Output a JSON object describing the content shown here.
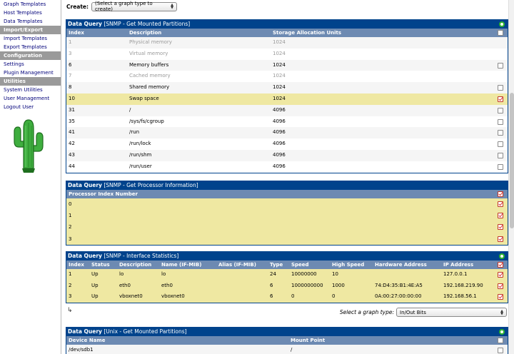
{
  "sidebar": {
    "items": [
      {
        "type": "link",
        "label": "Graph Templates"
      },
      {
        "type": "link",
        "label": "Host Templates"
      },
      {
        "type": "link",
        "label": "Data Templates"
      },
      {
        "type": "header",
        "label": "Import/Export"
      },
      {
        "type": "link",
        "label": "Import Templates"
      },
      {
        "type": "link",
        "label": "Export Templates"
      },
      {
        "type": "header",
        "label": "Configuration"
      },
      {
        "type": "link",
        "label": "Settings"
      },
      {
        "type": "link",
        "label": "Plugin Management"
      },
      {
        "type": "header",
        "label": "Utilities"
      },
      {
        "type": "link",
        "label": "System Utilities"
      },
      {
        "type": "link",
        "label": "User Management"
      },
      {
        "type": "link",
        "label": "Logout User"
      }
    ]
  },
  "create": {
    "label": "Create:",
    "select_value": "(Select a graph type to create)"
  },
  "mounted_partitions": {
    "title_prefix": "Data Query",
    "title_name": "[SNMP - Get Mounted Partitions]",
    "headers": [
      "Index",
      "Description",
      "Storage Allocation Units"
    ],
    "rows": [
      {
        "index": "1",
        "description": "Physical memory",
        "units": "1024",
        "disabled": true,
        "checked": false
      },
      {
        "index": "3",
        "description": "Virtual memory",
        "units": "1024",
        "disabled": true,
        "checked": false
      },
      {
        "index": "6",
        "description": "Memory buffers",
        "units": "1024",
        "disabled": false,
        "checked": false
      },
      {
        "index": "7",
        "description": "Cached memory",
        "units": "1024",
        "disabled": true,
        "checked": false
      },
      {
        "index": "8",
        "description": "Shared memory",
        "units": "1024",
        "disabled": false,
        "checked": false
      },
      {
        "index": "10",
        "description": "Swap space",
        "units": "1024",
        "disabled": false,
        "checked": true
      },
      {
        "index": "31",
        "description": "/",
        "units": "4096",
        "disabled": false,
        "checked": false
      },
      {
        "index": "35",
        "description": "/sys/fs/cgroup",
        "units": "4096",
        "disabled": false,
        "checked": false
      },
      {
        "index": "41",
        "description": "/run",
        "units": "4096",
        "disabled": false,
        "checked": false
      },
      {
        "index": "42",
        "description": "/run/lock",
        "units": "4096",
        "disabled": false,
        "checked": false
      },
      {
        "index": "43",
        "description": "/run/shm",
        "units": "4096",
        "disabled": false,
        "checked": false
      },
      {
        "index": "44",
        "description": "/run/user",
        "units": "4096",
        "disabled": false,
        "checked": false
      }
    ]
  },
  "processor_info": {
    "title_prefix": "Data Query",
    "title_name": "[SNMP - Get Processor Information]",
    "headers": [
      "Processor Index Number"
    ],
    "rows": [
      {
        "index": "0",
        "checked": true
      },
      {
        "index": "1",
        "checked": true
      },
      {
        "index": "2",
        "checked": true
      },
      {
        "index": "3",
        "checked": true
      }
    ]
  },
  "interface_stats": {
    "title_prefix": "Data Query",
    "title_name": "[SNMP - Interface Statistics]",
    "headers": [
      "Index",
      "Status",
      "Description",
      "Name (IF-MIB)",
      "Alias (IF-MIB)",
      "Type",
      "Speed",
      "High Speed",
      "Hardware Address",
      "IP Address"
    ],
    "rows": [
      {
        "cells": [
          "1",
          "Up",
          "lo",
          "lo",
          "",
          "24",
          "10000000",
          "10",
          "",
          "127.0.0.1"
        ],
        "checked": true
      },
      {
        "cells": [
          "2",
          "Up",
          "eth0",
          "eth0",
          "",
          "6",
          "1000000000",
          "1000",
          "74:D4:35:B1:4E:A5",
          "192.168.219.90"
        ],
        "checked": true
      },
      {
        "cells": [
          "3",
          "Up",
          "vboxnet0",
          "vboxnet0",
          "",
          "6",
          "0",
          "0",
          "0A:00:27:00:00:00",
          "192.168.56.1"
        ],
        "checked": true
      }
    ],
    "graph_type_label": "Select a graph type:",
    "graph_type_value": "In/Out Bits"
  },
  "unix_partitions": {
    "title_prefix": "Data Query",
    "title_name": "[Unix - Get Mounted Partitions]",
    "headers": [
      "Device Name",
      "Mount Point"
    ],
    "rows": [
      {
        "cells": [
          "/dev/sdb1",
          "/"
        ],
        "checked": false
      }
    ]
  }
}
